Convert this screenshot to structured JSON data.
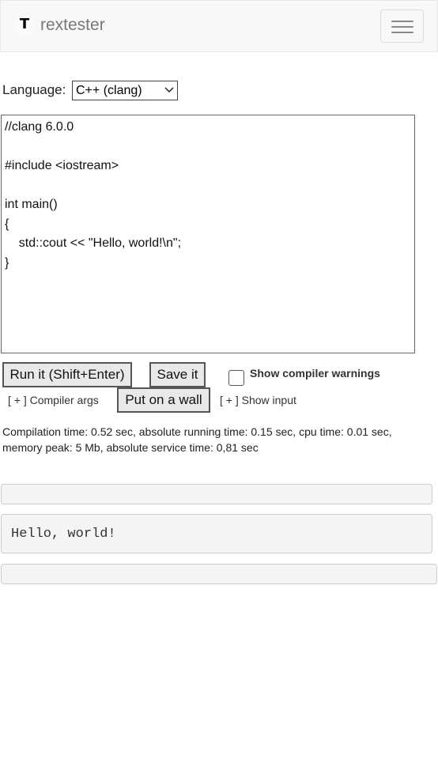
{
  "header": {
    "logo_text": "T",
    "brand": "rextester",
    "menu_icon": "hamburger-menu-icon"
  },
  "language": {
    "label": "Language:",
    "selected": "C++ (clang)"
  },
  "editor": {
    "code": "//clang 6.0.0\n\n#include <iostream>\n\nint main()\n{\n    std::cout << \"Hello, world!\\n\";\n}"
  },
  "actions": {
    "run_label": "Run it (Shift+Enter)",
    "save_label": "Save it",
    "wall_label": "Put on a wall",
    "warnings_label": "Show compiler warnings",
    "warnings_checked": false,
    "compiler_args_label": "[ + ] Compiler args",
    "show_input_label": "[ + ] Show input"
  },
  "stats": {
    "text": "Compilation time: 0.52 sec, absolute running time: 0.15 sec, cpu time: 0.01 sec, memory peak: 5 Mb, absolute service time: 0,81 sec"
  },
  "output": {
    "warnings": "",
    "result": "Hello, world!",
    "errors": ""
  }
}
